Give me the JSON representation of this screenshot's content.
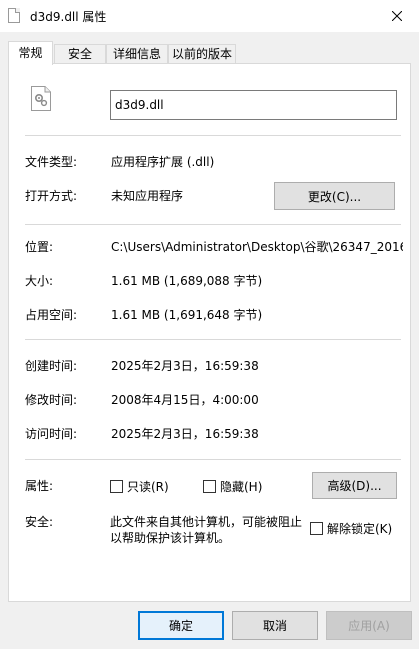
{
  "window": {
    "title": "d3d9.dll 属性"
  },
  "tabs": [
    {
      "label": "常规"
    },
    {
      "label": "安全"
    },
    {
      "label": "详细信息"
    },
    {
      "label": "以前的版本"
    }
  ],
  "file": {
    "name": "d3d9.dll"
  },
  "fields": {
    "type_label": "文件类型:",
    "type_value": "应用程序扩展 (.dll)",
    "open_label": "打开方式:",
    "open_value": "未知应用程序",
    "change_button": "更改(C)...",
    "location_label": "位置:",
    "location_value": "C:\\Users\\Administrator\\Desktop\\谷歌\\26347_2016",
    "size_label": "大小:",
    "size_value": "1.61 MB (1,689,088 字节)",
    "disk_label": "占用空间:",
    "disk_value": "1.61 MB (1,691,648 字节)",
    "created_label": "创建时间:",
    "created_value": "2025年2月3日，16:59:38",
    "modified_label": "修改时间:",
    "modified_value": "2008年4月15日，4:00:00",
    "accessed_label": "访问时间:",
    "accessed_value": "2025年2月3日，16:59:38",
    "attr_label": "属性:",
    "readonly_label": "只读(R)",
    "hidden_label": "隐藏(H)",
    "advanced_button": "高级(D)...",
    "security_label": "安全:",
    "security_line1": "此文件来自其他计算机，可能被阻止",
    "security_line2": "以帮助保护该计算机。",
    "unblock_label": "解除锁定(K)"
  },
  "footer": {
    "ok": "确定",
    "cancel": "取消",
    "apply": "应用(A)"
  }
}
